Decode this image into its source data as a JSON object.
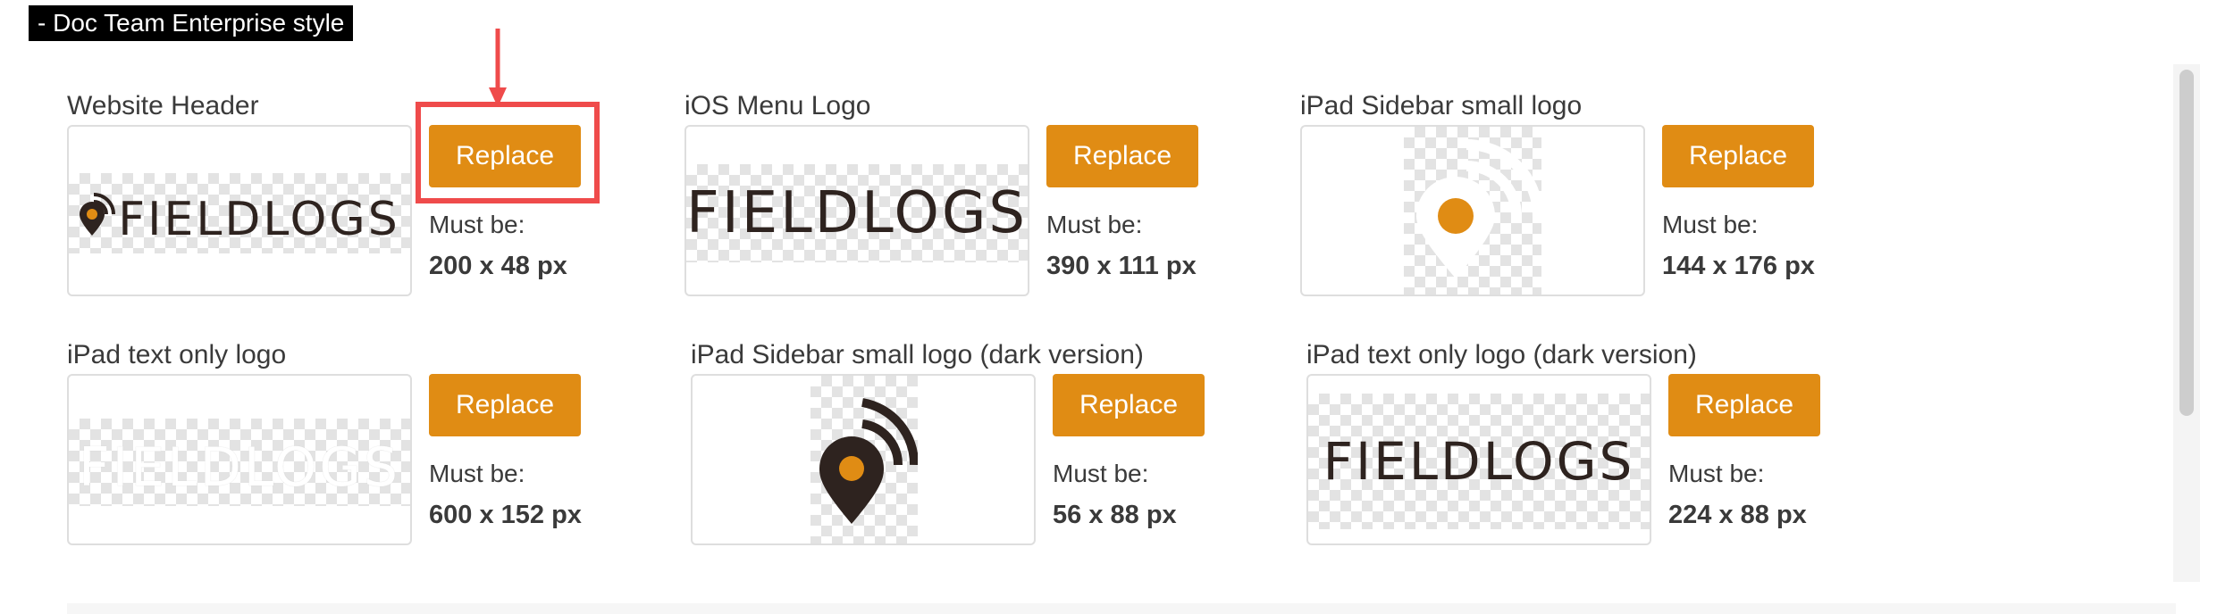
{
  "header": {
    "label": "- Doc Team Enterprise style"
  },
  "replace_label": "Replace",
  "must_be_label": "Must be:",
  "logos": [
    {
      "title": "Website Header",
      "size": "200 x 48 px",
      "preview_text": "FIELDLOGS"
    },
    {
      "title": "iOS Menu Logo",
      "size": "390 x 111 px",
      "preview_text": "FIELDLOGS"
    },
    {
      "title": "iPad Sidebar small logo",
      "size": "144 x 176 px"
    },
    {
      "title": "iPad text only logo",
      "size": "600 x 152 px",
      "preview_text": "FIELDLOGS"
    },
    {
      "title": "iPad Sidebar small logo (dark version)",
      "size": "56 x 88 px"
    },
    {
      "title": "iPad text only logo (dark version)",
      "size": "224 x 88 px",
      "preview_text": "FIELDLOGS"
    }
  ],
  "colors": {
    "accent": "#e08c14",
    "highlight": "#ef4b4b",
    "logo_dark": "#2e231f",
    "logo_white": "#ffffff"
  },
  "icons": [
    "location-pin-wifi-icon",
    "down-arrow-icon",
    "scrollbar"
  ]
}
